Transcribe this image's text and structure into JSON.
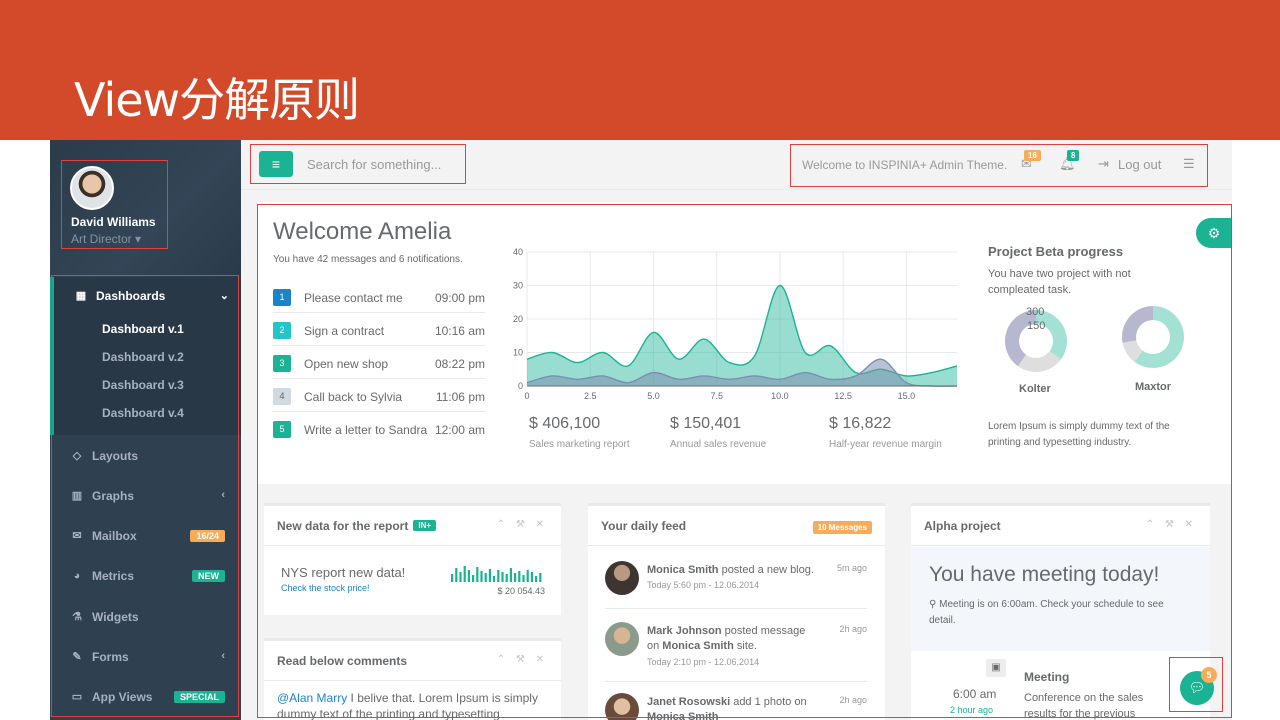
{
  "slide": {
    "title": "View分解原则"
  },
  "profile": {
    "name": "David Williams",
    "role": "Art Director"
  },
  "sidebar": {
    "dashboards": "Dashboards",
    "sub_items": [
      "Dashboard v.1",
      "Dashboard v.2",
      "Dashboard v.3",
      "Dashboard v.4"
    ],
    "items": [
      {
        "label": "Layouts",
        "icon": "diamond-icon"
      },
      {
        "label": "Graphs",
        "icon": "bar-chart-icon"
      },
      {
        "label": "Mailbox",
        "icon": "envelope-icon",
        "badge": "16/24",
        "badge_color": "#f8ac59"
      },
      {
        "label": "Metrics",
        "icon": "pie-chart-icon",
        "badge": "NEW",
        "badge_color": "#1ab394"
      },
      {
        "label": "Widgets",
        "icon": "flask-icon"
      },
      {
        "label": "Forms",
        "icon": "edit-icon"
      },
      {
        "label": "App Views",
        "icon": "desktop-icon",
        "badge": "SPECIAL",
        "badge_color": "#1ab394"
      }
    ]
  },
  "topbar": {
    "search_placeholder": "Search for something...",
    "welcome": "Welcome to INSPINIA+ Admin Theme.",
    "mail_count": "16",
    "bell_count": "8",
    "logout": "Log out"
  },
  "welcome": {
    "title": "Welcome Amelia",
    "subtitle": "You have 42 messages and 6 notifications.",
    "todos": [
      {
        "n": "1",
        "text": "Please contact me",
        "time": "09:00 pm",
        "color": "#1c84c6"
      },
      {
        "n": "2",
        "text": "Sign a contract",
        "time": "10:16 am",
        "color": "#23c6c8"
      },
      {
        "n": "3",
        "text": "Open new shop",
        "time": "08:22 pm",
        "color": "#1ab394"
      },
      {
        "n": "4",
        "text": "Call back to Sylvia",
        "time": "11:06 pm",
        "color": "#d1dade"
      },
      {
        "n": "5",
        "text": "Write a letter to Sandra",
        "time": "12:00 am",
        "color": "#1ab394"
      }
    ]
  },
  "chart_data": {
    "type": "area",
    "x_ticks": [
      "0",
      "2.5",
      "5.0",
      "7.5",
      "10.0",
      "12.5",
      "15.0"
    ],
    "y_ticks": [
      "0",
      "10",
      "20",
      "30",
      "40"
    ],
    "xlim": [
      0,
      17
    ],
    "ylim": [
      0,
      40
    ],
    "series": [
      {
        "values": [
          [
            0,
            8
          ],
          [
            1,
            10
          ],
          [
            2,
            7
          ],
          [
            3,
            10
          ],
          [
            4,
            6
          ],
          [
            5,
            16
          ],
          [
            6,
            8
          ],
          [
            7,
            14
          ],
          [
            8,
            7
          ],
          [
            9,
            9
          ],
          [
            10,
            30
          ],
          [
            11,
            10
          ],
          [
            12,
            12
          ],
          [
            13,
            4
          ],
          [
            14,
            5
          ],
          [
            15,
            3
          ],
          [
            16,
            4
          ],
          [
            17,
            6
          ]
        ],
        "color": "#1ab394"
      },
      {
        "values": [
          [
            0,
            1
          ],
          [
            1,
            3
          ],
          [
            2,
            2
          ],
          [
            3,
            3
          ],
          [
            4,
            1
          ],
          [
            5,
            4
          ],
          [
            6,
            2
          ],
          [
            7,
            3
          ],
          [
            8,
            2
          ],
          [
            9,
            3
          ],
          [
            10,
            2
          ],
          [
            11,
            4
          ],
          [
            12,
            2
          ],
          [
            13,
            3
          ],
          [
            14,
            8
          ],
          [
            15,
            1
          ],
          [
            16,
            0
          ],
          [
            17,
            0
          ]
        ],
        "color": "#7b8fb0"
      }
    ]
  },
  "stats": [
    {
      "value": "$ 406,100",
      "label": "Sales marketing report"
    },
    {
      "value": "$ 150,401",
      "label": "Annual sales revenue"
    },
    {
      "value": "$ 16,822",
      "label": "Half-year revenue margin"
    }
  ],
  "project": {
    "title": "Project Beta progress",
    "subtitle": "You have two project with not compleated task.",
    "kolter": "Kolter",
    "maxtor": "Maxtor",
    "v300": "300",
    "v150": "150",
    "footer": "Lorem Ipsum is simply dummy text of the printing and typesetting industry."
  },
  "cards": {
    "report": {
      "title": "New data for the report",
      "tag": "IN+",
      "headline": "NYS report new data!",
      "link": "Check the stock price!",
      "value": "$ 20 054.43"
    },
    "comments": {
      "title": "Read below comments",
      "mention": "@Alan Marry",
      "text": " I belive that. Lorem Ipsum is simply dummy text of the printing and typesetting"
    },
    "feed": {
      "title": "Your daily feed",
      "badge": "10 Messages",
      "items": [
        {
          "who": "Monica Smith",
          "what": " posted a new blog.",
          "date": "Today 5:60 pm - 12.06.2014",
          "ago": "5m ago"
        },
        {
          "who": "Mark Johnson",
          "what": " posted message on ",
          "who2": "Monica Smith",
          "what2": " site.",
          "date": "Today 2:10 pm - 12.06.2014",
          "ago": "2h ago"
        },
        {
          "who": "Janet Rosowski",
          "what": " add 1 photo on ",
          "who2": "Monica Smith",
          "ago": "2h ago"
        }
      ]
    },
    "alpha": {
      "title": "Alpha project",
      "headline": "You have meeting today!",
      "text": "Meeting is on 6:00am. Check your schedule to see detail.",
      "time": "6:00 am",
      "ago": "2 hour ago",
      "event": "Meeting",
      "event_text": "Conference on the sales results for the previous"
    }
  },
  "chat": {
    "count": "5"
  }
}
